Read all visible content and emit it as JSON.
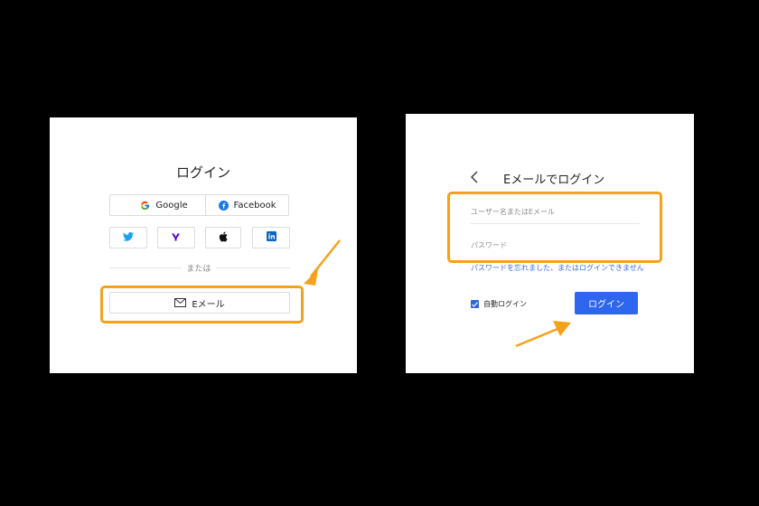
{
  "login_panel": {
    "title": "ログイン",
    "google_label": "Google",
    "facebook_label": "Facebook",
    "or_label": "または",
    "email_label": "Eメール"
  },
  "email_login_panel": {
    "title": "Eメールでログイン",
    "username_placeholder": "ユーザー名またはEメール",
    "password_placeholder": "パスワード",
    "forgot_link": "パスワードを忘れました、またはログインできません",
    "auto_login_label": "自動ログイン",
    "auto_login_checked": true,
    "login_button": "ログイン"
  },
  "icons": [
    "google-icon",
    "facebook-icon",
    "twitter-icon",
    "yahoo-icon",
    "apple-icon",
    "linkedin-icon",
    "mail-icon",
    "back-chevron-icon",
    "checkmark-icon",
    "annotation-arrow"
  ],
  "colors": {
    "highlight": "#f5a11b",
    "primary_button": "#2f66f0",
    "link": "#3a6fd6",
    "background": "#000000",
    "facebook": "#1877f2",
    "twitter": "#1da1f2",
    "yahoo": "#5f01d1",
    "linkedin": "#0a66c2"
  }
}
